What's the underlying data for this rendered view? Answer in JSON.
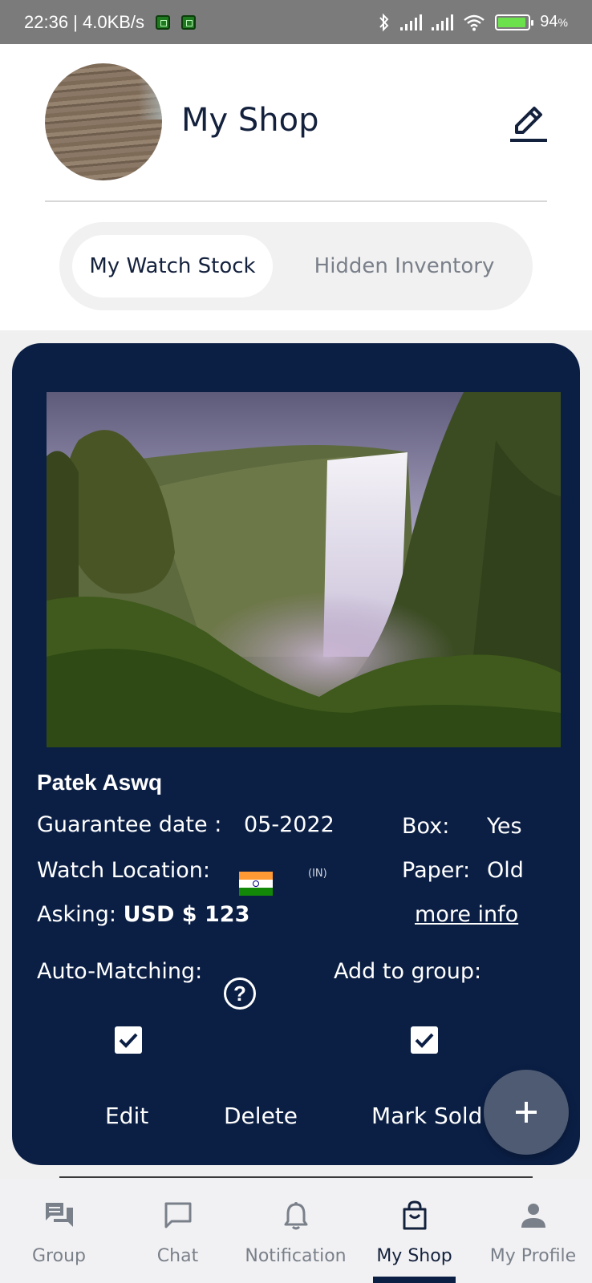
{
  "status_bar": {
    "time_speed": "22:36 | 4.0KB/s",
    "battery_level": "94",
    "battery_unit": "%"
  },
  "header": {
    "title": "My Shop",
    "edit_icon": "pencil-edit-icon"
  },
  "tabs": [
    {
      "label": "My Watch Stock",
      "active": true
    },
    {
      "label": "Hidden Inventory",
      "active": false
    }
  ],
  "listing": {
    "name": "Patek Aswq",
    "guarantee_label": "Guarantee date :",
    "guarantee_value": "05-2022",
    "box_label": "Box:",
    "box_value": "Yes",
    "location_label": "Watch Location:",
    "location_flag": "india-flag-icon",
    "location_code": "(IN)",
    "paper_label": "Paper:",
    "paper_value": "Old",
    "asking_label": "Asking:",
    "asking_value": "USD $ 123",
    "more_info": "more info",
    "auto_matching_label": "Auto-Matching:",
    "auto_matching_checked": true,
    "add_group_label": "Add to group:",
    "add_group_checked": true,
    "actions": {
      "edit": "Edit",
      "delete": "Delete",
      "mark_sold": "Mark Sold"
    }
  },
  "fab": {
    "icon": "plus-icon"
  },
  "bottom_nav": [
    {
      "label": "Group",
      "icon": "group-chat-icon",
      "active": false
    },
    {
      "label": "Chat",
      "icon": "chat-bubble-icon",
      "active": false
    },
    {
      "label": "Notification",
      "icon": "bell-icon",
      "active": false
    },
    {
      "label": "My Shop",
      "icon": "shopping-bag-icon",
      "active": true
    },
    {
      "label": "My Profile",
      "icon": "person-icon",
      "active": false
    }
  ],
  "colors": {
    "navy": "#0b1f45",
    "title": "#14213d",
    "inactive": "#7a808a",
    "fab": "#4e5b73"
  }
}
